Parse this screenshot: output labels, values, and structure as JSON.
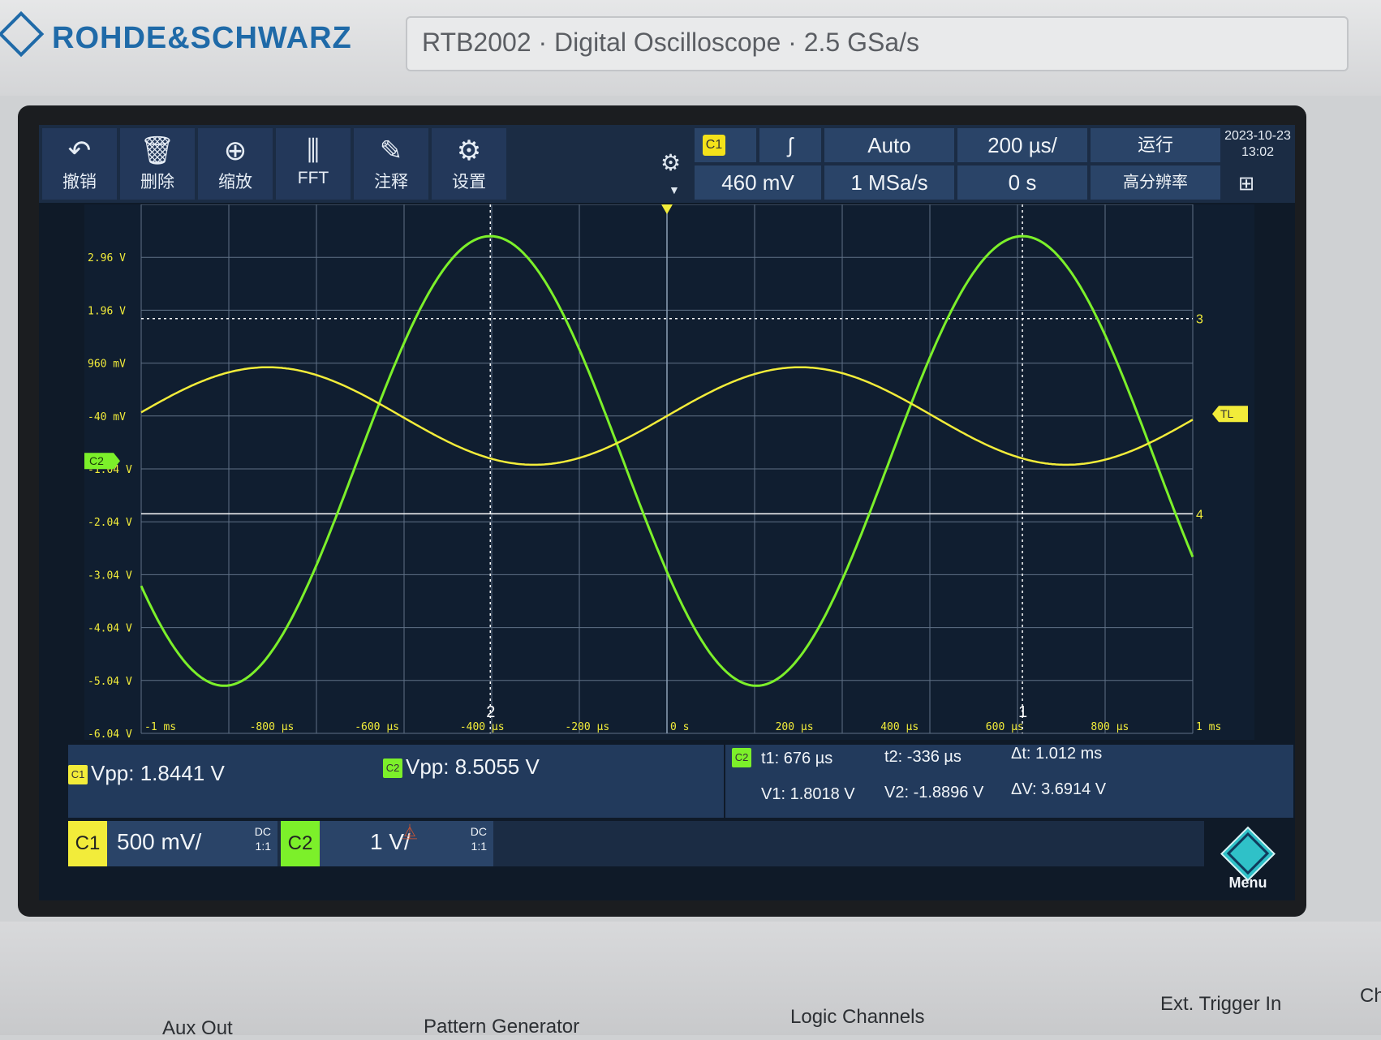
{
  "header": {
    "brand": "ROHDE&SCHWARZ",
    "model_line": "RTB2002  ·  Digital Oscilloscope  ·  2.5 GSa/s"
  },
  "toolbar": {
    "tools": [
      {
        "label": "撤销",
        "icon": "undo-icon",
        "glyph": "↶"
      },
      {
        "label": "删除",
        "icon": "trash-icon",
        "glyph": "🗑"
      },
      {
        "label": "缩放",
        "icon": "zoom-icon",
        "glyph": "⊕"
      },
      {
        "label": "FFT",
        "icon": "fft-icon",
        "glyph": "⫼"
      },
      {
        "label": "注释",
        "icon": "pencil-icon",
        "glyph": "✎"
      },
      {
        "label": "设置",
        "icon": "settings-icon",
        "glyph": "⚙"
      }
    ],
    "trigger_source": "C1",
    "trigger_slope": "ʃ",
    "trigger_level": "460 mV",
    "trigger_mode": "Auto",
    "sample_rate": "1 MSa/s",
    "timebase": "200 µs/",
    "horizontal_position": "0 s",
    "run_state": "运行",
    "acq_mode": "高分辨率",
    "date": "2023-10-23",
    "time": "13:02"
  },
  "plot": {
    "y_labels": [
      "2.96 V",
      "1.96 V",
      "960 mV",
      "-40 mV",
      "-1.04 V",
      "-2.04 V",
      "-3.04 V",
      "-4.04 V",
      "-5.04 V",
      "-6.04 V"
    ],
    "x_labels": [
      "-1 ms",
      "-800 µs",
      "-600 µs",
      "-400 µs",
      "-200 µs",
      "0 s",
      "200 µs",
      "400 µs",
      "600 µs",
      "800 µs",
      "1 ms"
    ],
    "c2_marker": "C2",
    "tl_marker": "TL",
    "cursor_labels": {
      "h1": "3",
      "h2": "4",
      "v1": "1",
      "v2": "2"
    },
    "colors": {
      "ch1": "#f2ec3a",
      "ch2": "#7cf02a",
      "grid": "#5f7086",
      "bg": "#101e30"
    }
  },
  "chart_data": {
    "type": "line",
    "xlabel": "",
    "ylabel": "",
    "xlim": [
      -1.0,
      1.0
    ],
    "x_unit": "ms",
    "ylim": [
      -6.04,
      3.96
    ],
    "series": [
      {
        "name": "C1",
        "type": "sine",
        "amplitude_v": 0.922,
        "offset_v": -0.04,
        "peak_v": 0.88,
        "trough_v": -0.96,
        "period_ms": 1.012,
        "zero_phase_x_ms": 0.0,
        "rising_at_x0": true
      },
      {
        "name": "C2",
        "type": "sine",
        "amplitude_v": 4.25,
        "offset_v": -0.89,
        "peak_v": 3.36,
        "trough_v": -5.14,
        "period_ms": 1.012,
        "peak_x_ms": -0.336
      }
    ],
    "cursors": {
      "t1_ms": 0.676,
      "t2_ms": -0.336,
      "v1_v": 1.8018,
      "v2_v": -1.8896
    }
  },
  "measurements": {
    "c1_tag": "C1",
    "c1_vpp": "Vpp: 1.8441 V",
    "c2_tag": "C2",
    "c2_vpp": "Vpp: 8.5055 V",
    "cursor_tag": "C2",
    "t1": "t1: 676 µs",
    "t2": "t2: -336 µs",
    "dt": "Δt: 1.012 ms",
    "v1": "V1: 1.8018 V",
    "v2": "V2: -1.8896 V",
    "dv": "ΔV: 3.6914 V"
  },
  "channels": {
    "c1": {
      "tag": "C1",
      "scale": "500 mV/",
      "coupling": "DC",
      "probe": "1:1"
    },
    "c2": {
      "tag": "C2",
      "scale": "1 V/",
      "coupling": "DC",
      "probe": "1:1"
    }
  },
  "menu_label": "Menu",
  "panel_labels": {
    "aux_out": "Aux Out",
    "pattern_gen": "Pattern Generator",
    "logic": "Logic Channels",
    "ext_trig": "Ext. Trigger In",
    "ch": "Ch"
  }
}
